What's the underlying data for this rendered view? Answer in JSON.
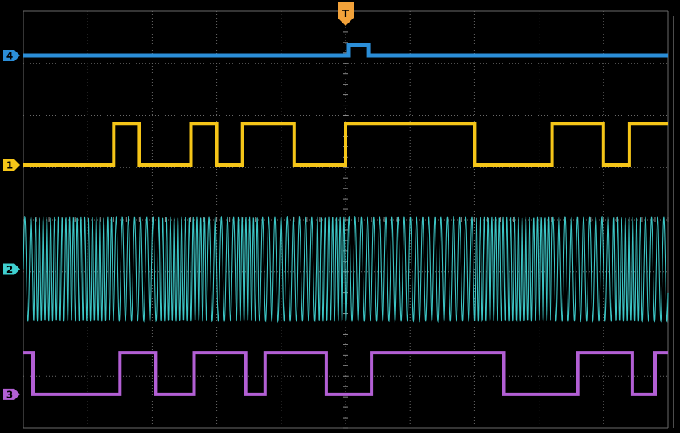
{
  "chart_data": {
    "type": "line",
    "title": "",
    "xlabel": "",
    "ylabel": "",
    "xlim": [
      -5,
      5
    ],
    "ylim": [
      -4,
      4
    ],
    "grid": true,
    "trigger_marker": "T",
    "bit_edges": [
      -4.85,
      -3.6,
      -2.9,
      -2.15,
      -1.7,
      -1.35,
      -0.45,
      0.0,
      2.0,
      3.2,
      4.15,
      4.6
    ],
    "series": [
      {
        "name": "4",
        "label": "4",
        "color": "#2b8ed8",
        "label_y": 3.15,
        "x": [
          -5.0,
          0.05,
          0.05,
          0.35,
          0.35,
          5.0
        ],
        "y": [
          3.15,
          3.15,
          3.35,
          3.35,
          3.15,
          3.15
        ]
      },
      {
        "name": "1",
        "label": "1",
        "color": "#f5c518",
        "label_y": 1.05,
        "x": [
          -5.0,
          -3.6,
          -3.6,
          -3.2,
          -3.2,
          -2.4,
          -2.4,
          -2.0,
          -2.0,
          -1.6,
          -1.6,
          -0.8,
          -0.8,
          0.0,
          0.0,
          2.0,
          2.0,
          3.2,
          3.2,
          4.0,
          4.0,
          4.4,
          4.4,
          5.0
        ],
        "y": [
          1.05,
          1.05,
          1.85,
          1.85,
          1.05,
          1.05,
          1.85,
          1.85,
          1.05,
          1.05,
          1.85,
          1.85,
          1.05,
          1.05,
          1.85,
          1.85,
          1.05,
          1.05,
          1.85,
          1.85,
          1.05,
          1.05,
          1.85,
          1.85
        ]
      },
      {
        "name": "2",
        "label": "2",
        "color": "#3fd0d0",
        "label_y": -0.95,
        "amplitude": 1.0,
        "offset": -0.95
      },
      {
        "name": "3",
        "label": "3",
        "color": "#b25fd4",
        "label_y": -3.35,
        "x": [
          -5.0,
          -4.85,
          -4.85,
          -3.5,
          -3.5,
          -2.95,
          -2.95,
          -2.35,
          -2.35,
          -1.55,
          -1.55,
          -1.25,
          -1.25,
          -1.2,
          -1.2,
          -0.3,
          -0.3,
          0.4,
          0.4,
          2.45,
          2.45,
          3.6,
          3.6,
          4.45,
          4.45,
          4.8,
          4.8,
          5.0
        ],
        "y": [
          -2.55,
          -2.55,
          -3.35,
          -3.35,
          -2.55,
          -2.55,
          -3.35,
          -3.35,
          -2.55,
          -2.55,
          -3.35,
          -3.35,
          -2.55,
          -2.55,
          -2.55,
          -2.55,
          -3.35,
          -3.35,
          -2.55,
          -2.55,
          -3.35,
          -3.35,
          -2.55,
          -2.55,
          -3.35,
          -3.35,
          -2.55,
          -2.55
        ]
      }
    ]
  }
}
